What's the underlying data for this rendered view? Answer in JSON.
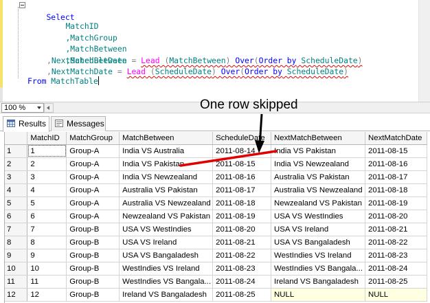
{
  "query": {
    "select_kw": "Select",
    "col_matchid": "MatchID",
    "col_matchgroup": ",MatchGroup",
    "col_matchbetween": ",MatchBetween",
    "col_scheduledate": ",ScheduleDate",
    "line5_comma": ",",
    "line5_alias": "NextMatchBetween",
    "line5_eq": "=",
    "line5_fn": "Lead",
    "line5_open": "(",
    "line5_arg": "MatchBetween",
    "line5_close": ")",
    "line5_over": "Over",
    "line5_open2": "(",
    "line5_order": "Order by",
    "line5_orderarg": "ScheduleDate",
    "line5_close2": ")",
    "line6_comma": ",",
    "line6_alias": "NextMatchDate",
    "line6_eq": "=",
    "line6_fn": "Lead",
    "line6_open": "(",
    "line6_arg": "ScheduleDate",
    "line6_close": ")",
    "line6_over": "Over",
    "line6_open2": "(",
    "line6_order": "Order by",
    "line6_orderarg": "ScheduleDate",
    "line6_close2": ")",
    "from_kw": "From",
    "table_name": "MatchTable"
  },
  "zoom": {
    "value": "100 %"
  },
  "annotation": "One row skipped",
  "tabs": [
    {
      "label": "Results"
    },
    {
      "label": "Messages"
    }
  ],
  "grid": {
    "columns": [
      "MatchID",
      "MatchGroup",
      "MatchBetween",
      "ScheduleDate",
      "NextMatchBetween",
      "NextMatchDate"
    ],
    "rows": [
      {
        "n": "1",
        "cells": [
          "1",
          "Group-A",
          "India VS Australia",
          "2011-08-14",
          "India VS Pakistan",
          "2011-08-15"
        ]
      },
      {
        "n": "2",
        "cells": [
          "2",
          "Group-A",
          "India VS Pakistan",
          "2011-08-15",
          "India VS Newzealand",
          "2011-08-16"
        ]
      },
      {
        "n": "3",
        "cells": [
          "3",
          "Group-A",
          "India VS Newzealand",
          "2011-08-16",
          "Australia VS Pakistan",
          "2011-08-17"
        ]
      },
      {
        "n": "4",
        "cells": [
          "4",
          "Group-A",
          "Australia VS Pakistan",
          "2011-08-17",
          "Australia VS Newzealand",
          "2011-08-18"
        ]
      },
      {
        "n": "5",
        "cells": [
          "5",
          "Group-A",
          "Australia VS Newzealand",
          "2011-08-18",
          "Newzealand VS Pakistan",
          "2011-08-19"
        ]
      },
      {
        "n": "6",
        "cells": [
          "6",
          "Group-A",
          "Newzealand VS Pakistan",
          "2011-08-19",
          "USA VS WestIndies",
          "2011-08-20"
        ]
      },
      {
        "n": "7",
        "cells": [
          "7",
          "Group-B",
          "USA VS WestIndies",
          "2011-08-20",
          "USA VS Ireland",
          "2011-08-21"
        ]
      },
      {
        "n": "8",
        "cells": [
          "8",
          "Group-B",
          "USA VS Ireland",
          "2011-08-21",
          "USA VS Bangaladesh",
          "2011-08-22"
        ]
      },
      {
        "n": "9",
        "cells": [
          "9",
          "Group-B",
          "USA VS Bangaladesh",
          "2011-08-22",
          "WestIndies VS Ireland",
          "2011-08-23"
        ]
      },
      {
        "n": "10",
        "cells": [
          "10",
          "Group-B",
          "WestIndies VS Ireland",
          "2011-08-23",
          "WestIndies VS Bangala...",
          "2011-08-24"
        ]
      },
      {
        "n": "11",
        "cells": [
          "11",
          "Group-B",
          "WestIndies VS Bangala...",
          "2011-08-24",
          "Ireland VS Bangaladesh",
          "2011-08-25"
        ]
      },
      {
        "n": "12",
        "cells": [
          "12",
          "Group-B",
          "Ireland VS Bangaladesh",
          "2011-08-25",
          "NULL",
          "NULL"
        ]
      }
    ]
  },
  "colors": {
    "keyword": "#0000ff",
    "identifier": "#008080",
    "function": "#ff00ff",
    "operator": "#808080",
    "annotation_line": "#e00000",
    "null_cell_bg": "#ffffe1"
  }
}
